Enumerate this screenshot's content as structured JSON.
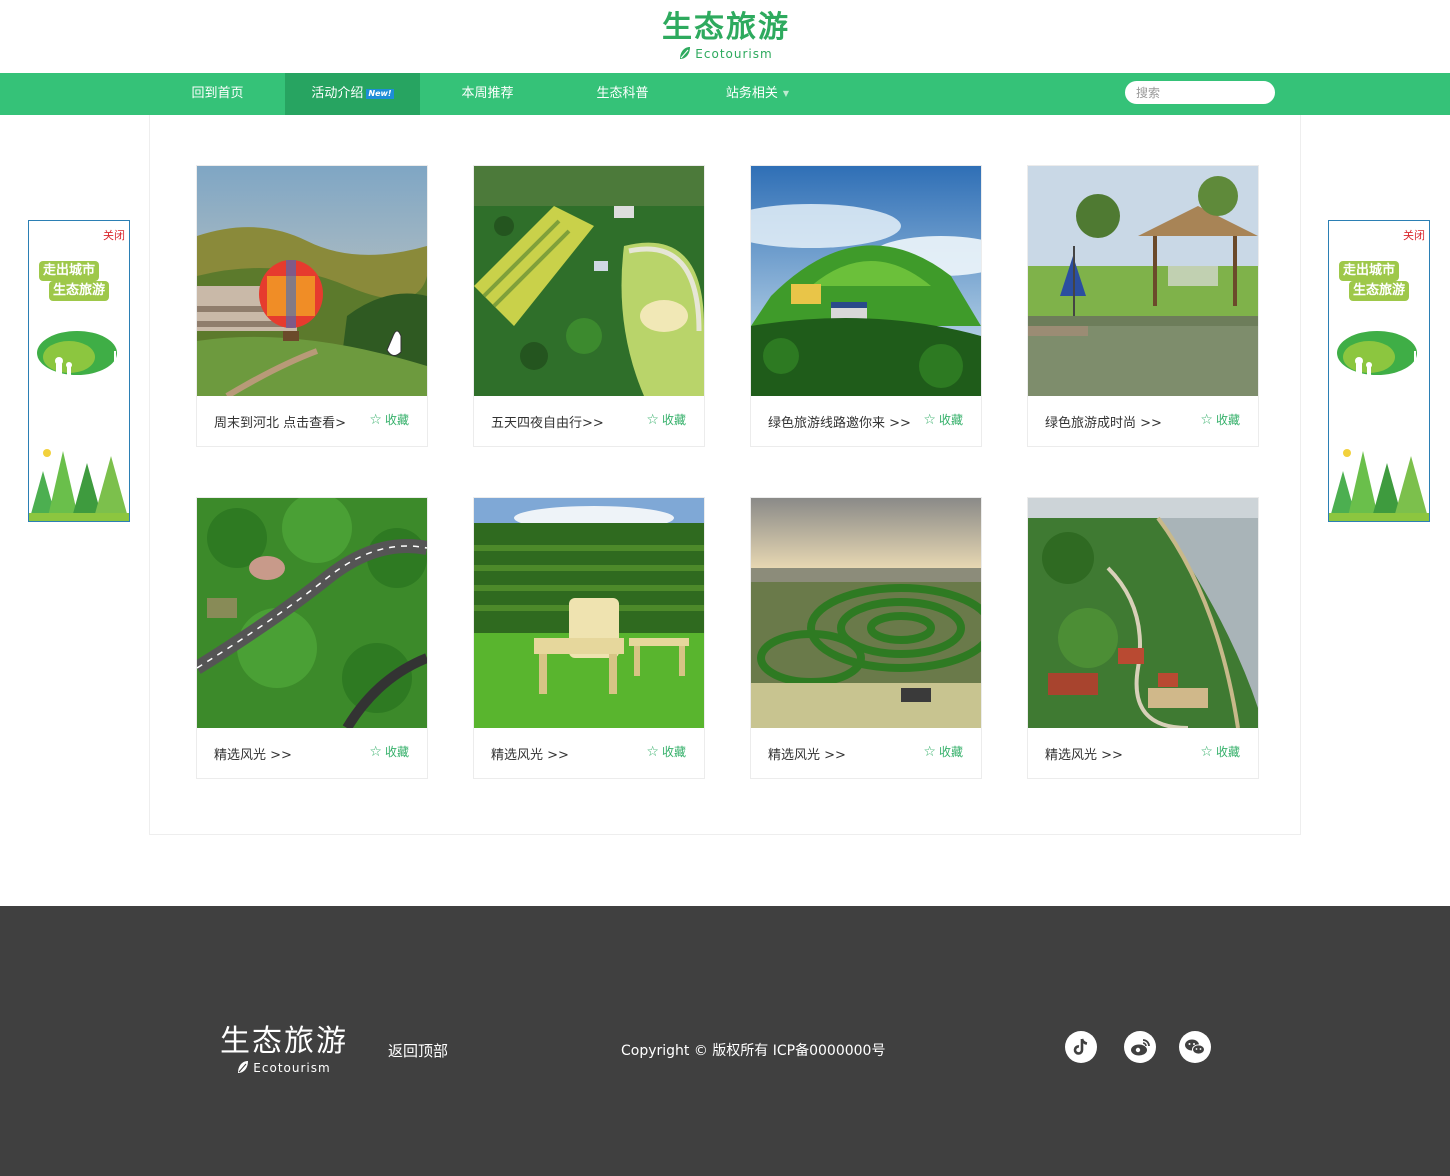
{
  "header": {
    "logo_cn": "生态旅游",
    "logo_en": "Ecotourism"
  },
  "nav": {
    "items": [
      {
        "label": "回到首页"
      },
      {
        "label": "活动介绍",
        "badge": "New!"
      },
      {
        "label": "本周推荐"
      },
      {
        "label": "生态科普"
      },
      {
        "label": "站务相关"
      }
    ],
    "search_placeholder": "搜索"
  },
  "side_ad": {
    "close_label": "关闭",
    "line1": "走出城市",
    "line2": "生态旅游"
  },
  "cards": [
    {
      "title": "周末到河北 点击查看>",
      "fav": "收藏"
    },
    {
      "title": "五天四夜自由行>>",
      "fav": "收藏"
    },
    {
      "title": "绿色旅游线路邀你来 >>",
      "fav": "收藏"
    },
    {
      "title": "绿色旅游成时尚 >>",
      "fav": "收藏"
    },
    {
      "title": "精选风光 >>",
      "fav": "收藏"
    },
    {
      "title": "精选风光 >>",
      "fav": "收藏"
    },
    {
      "title": "精选风光 >>",
      "fav": "收藏"
    },
    {
      "title": "精选风光 >>",
      "fav": "收藏"
    }
  ],
  "footer": {
    "logo_cn": "生态旅游",
    "logo_en": "Ecotourism",
    "back_to_top": "返回顶部",
    "copyright": "Copyright ©   版权所有  ICP备0000000号",
    "social_icons": [
      "tiktok-icon",
      "weibo-icon",
      "wechat-icon"
    ]
  },
  "colors": {
    "brand_green": "#35c278",
    "nav_active": "#27a461",
    "footer_bg": "#404040"
  }
}
